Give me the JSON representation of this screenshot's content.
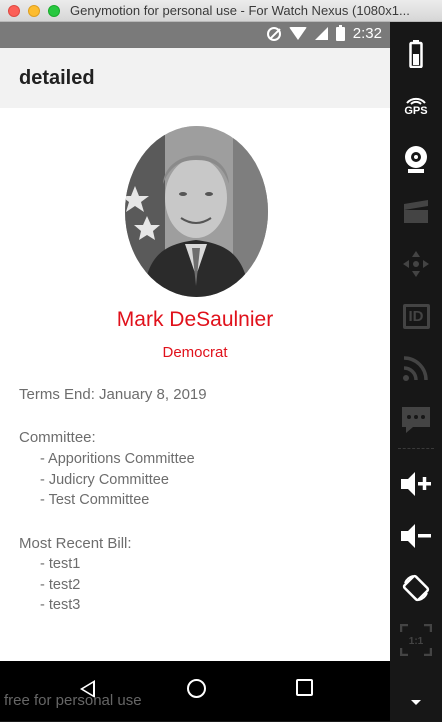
{
  "window": {
    "title": "Genymotion for personal use - For Watch Nexus (1080x1..."
  },
  "status_bar": {
    "time": "2:32",
    "icons": [
      "do-not-disturb-icon",
      "wifi-icon",
      "signal-icon",
      "battery-icon"
    ]
  },
  "app_bar": {
    "title": "detailed"
  },
  "profile": {
    "name": "Mark DeSaulnier",
    "party": "Democrat",
    "terms_end": "Terms End: January 8, 2019",
    "committee_label": "Committee:",
    "committees": [
      "- Apporitions Committee",
      "- Judicry Committee",
      "- Test Committee"
    ],
    "bill_label": "Most Recent Bill:",
    "bills": [
      "- test1",
      "- test2",
      "- test3"
    ]
  },
  "nav_bar": {
    "icons": [
      "back-icon",
      "home-icon",
      "recent-apps-icon"
    ]
  },
  "watermark": "free for personal use",
  "sidebar": {
    "gps_label": "GPS",
    "id_label": "ID",
    "ratio_label": "1:1",
    "items": [
      "battery-icon",
      "gps-icon",
      "webcam-icon",
      "capture-icon",
      "dpad-icon",
      "id-icon",
      "network-icon",
      "sms-icon",
      "volume-up-icon",
      "volume-down-icon",
      "rotate-icon",
      "scale-icon",
      "more-icon"
    ]
  },
  "colors": {
    "accent_red": "#e0111b",
    "text_gray": "#6d6d6d",
    "app_bar_bg": "#f2f2f2",
    "status_bar_bg": "#7a7a7a"
  }
}
